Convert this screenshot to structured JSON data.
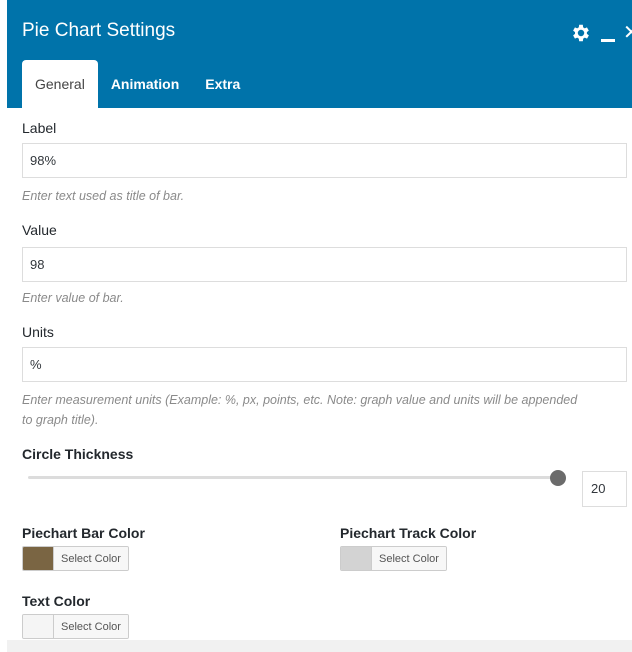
{
  "window": {
    "title": "Pie Chart Settings",
    "icons": [
      "gear-icon",
      "minimize-icon",
      "close-icon"
    ]
  },
  "tabs": [
    {
      "label": "General",
      "active": true
    },
    {
      "label": "Animation",
      "active": false
    },
    {
      "label": "Extra",
      "active": false
    }
  ],
  "fields": {
    "label": {
      "title": "Label",
      "value": "98%",
      "help": "Enter text used as title of bar."
    },
    "value": {
      "title": "Value",
      "value": "98",
      "help": "Enter value of bar."
    },
    "units": {
      "title": "Units",
      "value": "%",
      "help": "Enter measurement units (Example: %, px, points, etc. Note: graph value and units will be appended to graph title)."
    },
    "circle_thickness": {
      "title": "Circle Thickness",
      "value": "20",
      "level_percent": 100
    },
    "bar_color": {
      "title": "Piechart Bar Color",
      "button_label": "Select Color",
      "color": "#7a6543"
    },
    "track_color": {
      "title": "Piechart Track Color",
      "button_label": "Select Color",
      "color": "#d3d3d3"
    },
    "text_color": {
      "title": "Text Color",
      "button_label": "Select Color",
      "color": "#f5f5f5"
    }
  },
  "colors": {
    "header_bg": "#0073aa",
    "help_text": "#8a8a8a"
  }
}
